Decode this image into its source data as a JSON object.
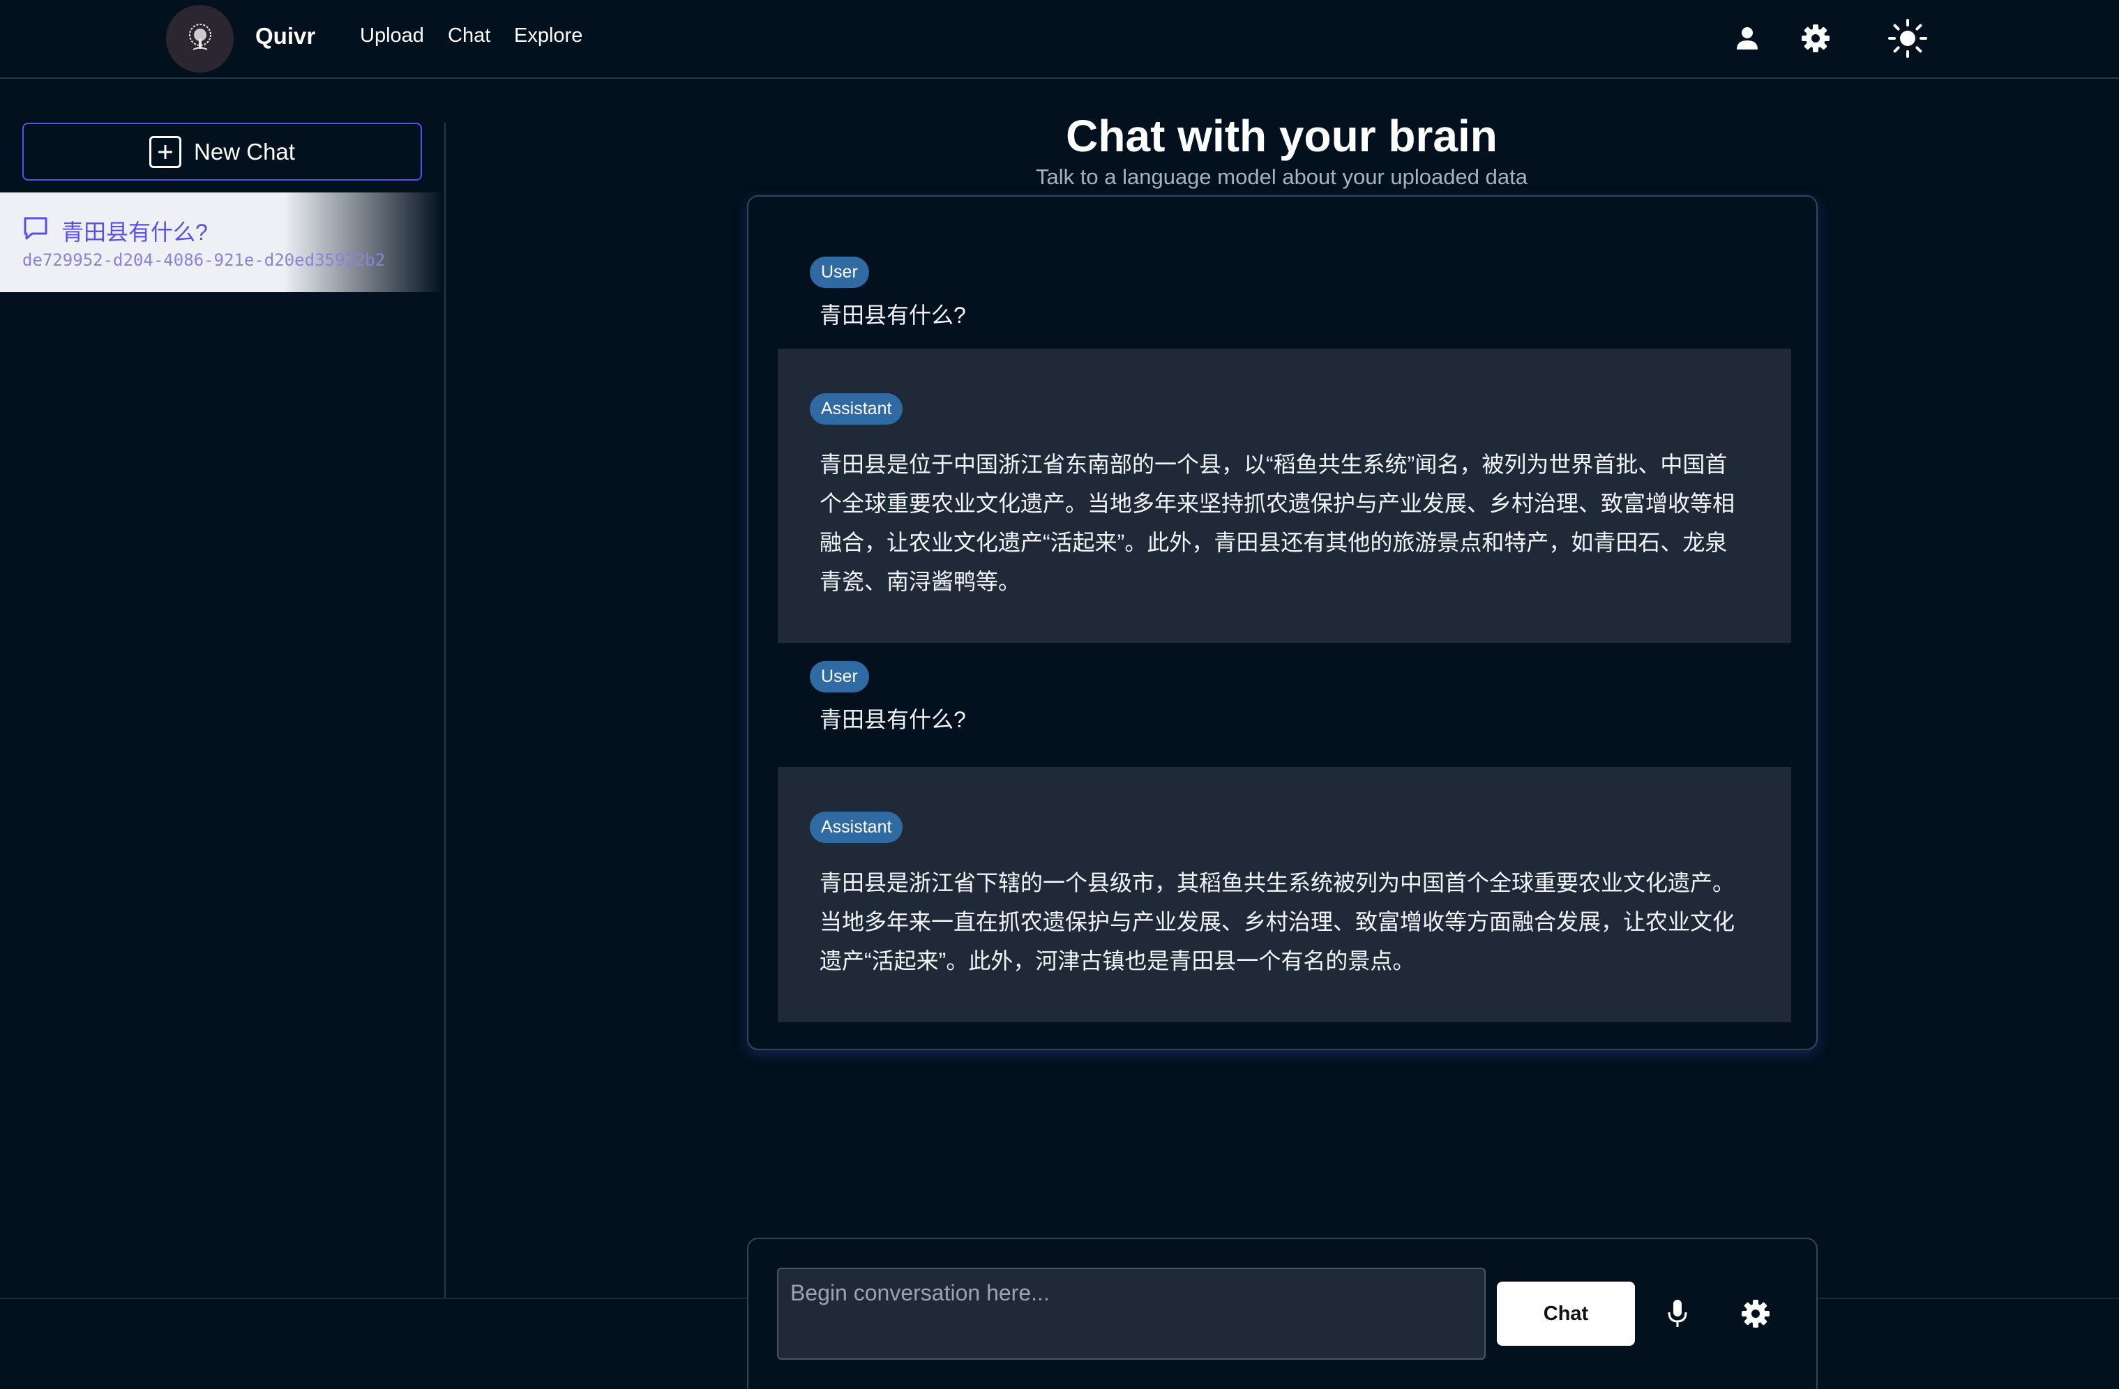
{
  "app": {
    "name": "Quivr",
    "logo_icon": "tree-icon"
  },
  "nav": {
    "links": [
      "Upload",
      "Chat",
      "Explore"
    ],
    "icons": [
      "user-icon",
      "gear-icon",
      "sun-icon"
    ]
  },
  "sidebar": {
    "new_chat_label": "New Chat",
    "chats": [
      {
        "title": "青田县有什么?",
        "id": "de729952-d204-4086-921e-d20ed35922b2",
        "icon": "chat-bubble-icon"
      }
    ]
  },
  "main": {
    "title": "Chat with your brain",
    "subtitle": "Talk to a language model about your uploaded data",
    "messages": [
      {
        "role": "User",
        "text": "青田县有什么?"
      },
      {
        "role": "Assistant",
        "text": "青田县是位于中国浙江省东南部的一个县，以“稻鱼共生系统”闻名，被列为世界首批、中国首个全球重要农业文化遗产。当地多年来坚持抓农遗保护与产业发展、乡村治理、致富增收等相融合，让农业文化遗产“活起来”。此外，青田县还有其他的旅游景点和特产，如青田石、龙泉青瓷、南浔酱鸭等。"
      },
      {
        "role": "User",
        "text": "青田县有什么?"
      },
      {
        "role": "Assistant",
        "text": "青田县是浙江省下辖的一个县级市，其稻鱼共生系统被列为中国首个全球重要农业文化遗产。当地多年来一直在抓农遗保护与产业发展、乡村治理、致富增收等方面融合发展，让农业文化遗产“活起来”。此外，河津古镇也是青田县一个有名的景点。"
      }
    ]
  },
  "composer": {
    "placeholder": "Begin conversation here...",
    "value": "",
    "submit_label": "Chat",
    "icons": [
      "microphone-icon",
      "gear-icon"
    ]
  },
  "colors": {
    "background": "#03111e",
    "accent": "#5a4ff0",
    "badge": "#2f6aa3",
    "assistant_bg": "#1f2937"
  }
}
